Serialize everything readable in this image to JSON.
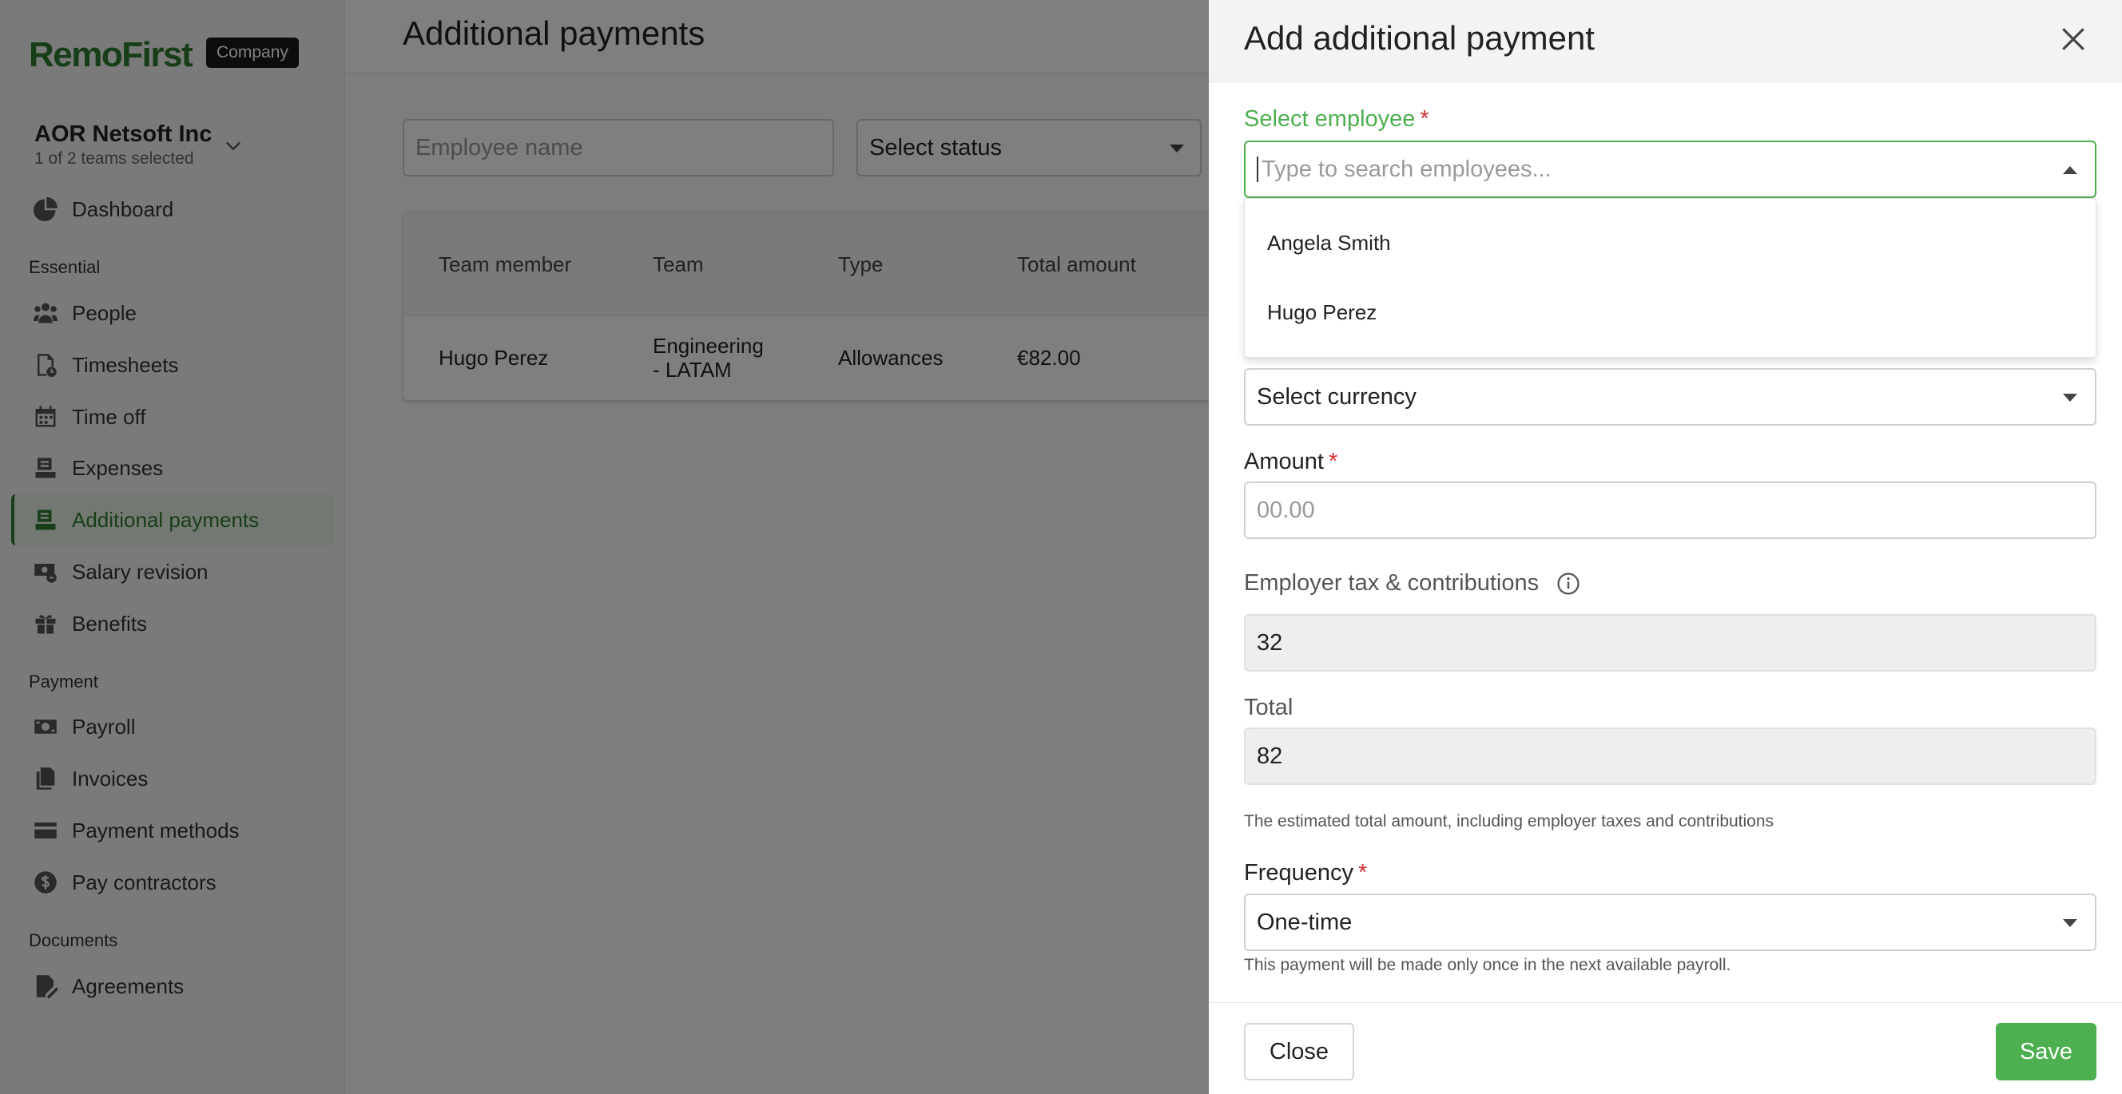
{
  "sidebar": {
    "logo": "RemoFirst",
    "badge": "Company",
    "org": {
      "name": "AOR Netsoft Inc",
      "sub": "1 of 2 teams selected"
    },
    "sections": {
      "essential": "Essential",
      "payment": "Payment",
      "documents": "Documents"
    },
    "items": [
      {
        "label": "Dashboard",
        "icon": "pie-chart-icon"
      },
      {
        "label": "People",
        "icon": "people-icon"
      },
      {
        "label": "Timesheets",
        "icon": "timesheet-icon"
      },
      {
        "label": "Time off",
        "icon": "calendar-icon"
      },
      {
        "label": "Expenses",
        "icon": "receipt-icon"
      },
      {
        "label": "Additional payments",
        "icon": "money-stack-icon",
        "active": true
      },
      {
        "label": "Salary revision",
        "icon": "salary-revision-icon"
      },
      {
        "label": "Benefits",
        "icon": "gift-icon"
      },
      {
        "label": "Payroll",
        "icon": "banknote-icon"
      },
      {
        "label": "Invoices",
        "icon": "invoice-icon"
      },
      {
        "label": "Payment methods",
        "icon": "credit-card-icon"
      },
      {
        "label": "Pay contractors",
        "icon": "dollar-coin-icon"
      },
      {
        "label": "Agreements",
        "icon": "document-edit-icon"
      }
    ]
  },
  "main": {
    "title": "Additional payments",
    "filters": {
      "employee_placeholder": "Employee name",
      "status_select": "Select status"
    },
    "table": {
      "headers": [
        "Team member",
        "Team",
        "Type",
        "Total amount"
      ],
      "rows": [
        {
          "member": "Hugo Perez",
          "team_line1": "Engineering",
          "team_line2": "- LATAM",
          "type": "Allowances",
          "amount": "€82.00"
        }
      ]
    }
  },
  "drawer": {
    "title": "Add additional payment",
    "employee": {
      "label": "Select employee",
      "placeholder": "Type to search employees...",
      "options": [
        "Angela Smith",
        "Hugo Perez"
      ]
    },
    "currency": {
      "value": "Select currency"
    },
    "amount": {
      "label": "Amount",
      "placeholder": "00.00"
    },
    "employer_tax": {
      "label": "Employer tax & contributions",
      "value": "32"
    },
    "total": {
      "label": "Total",
      "value": "82",
      "helper": "The estimated total amount, including employer taxes and contributions"
    },
    "frequency": {
      "label": "Frequency",
      "value": "One-time",
      "helper": "This payment will be made only once in the next available payroll."
    },
    "buttons": {
      "close": "Close",
      "save": "Save"
    },
    "colors": {
      "accent": "#4caf50",
      "brand": "#2e7d32",
      "required": "#d32f2f"
    }
  }
}
